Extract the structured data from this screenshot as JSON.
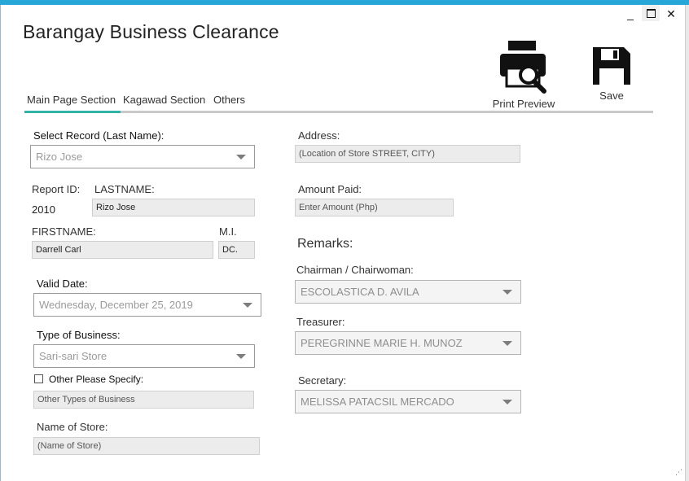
{
  "window": {
    "title": "Barangay Business Clearance",
    "controls": {
      "minimize": "_",
      "maximize": "☐",
      "close": "✕"
    }
  },
  "tabs": [
    {
      "label": "Main Page Section",
      "active": true
    },
    {
      "label": "Kagawad Section",
      "active": false
    },
    {
      "label": "Others",
      "active": false
    }
  ],
  "toolbar": {
    "print_preview_label": "Print Preview",
    "save_label": "Save"
  },
  "left": {
    "select_record_label": "Select Record (Last Name):",
    "select_record_value": "Rizo Jose",
    "report_id_label": "Report ID:",
    "report_id_value": "2010",
    "lastname_label": "LASTNAME:",
    "lastname_value": "Rizo Jose",
    "firstname_label": "FIRSTNAME:",
    "firstname_value": "Darrell Carl",
    "mi_label": "M.I.",
    "mi_value": "DC.",
    "valid_date_label": "Valid Date:",
    "valid_date_value": "Wednesday, December 25, 2019",
    "type_of_business_label": "Type of Business:",
    "type_of_business_value": "Sari-sari Store",
    "other_specify_label": "Other Please Specify:",
    "other_specify_checked": false,
    "other_types_placeholder": "Other Types of Business",
    "name_of_store_label": "Name of Store:",
    "name_of_store_placeholder": "(Name of Store)"
  },
  "right": {
    "address_label": "Address:",
    "address_placeholder": "(Location of Store STREET, CITY)",
    "amount_paid_label": "Amount Paid:",
    "amount_placeholder": "Enter Amount (Php)",
    "remarks_label": "Remarks:",
    "chairman_label": "Chairman / Chairwoman:",
    "chairman_value": "ESCOLASTICA D. AVILA",
    "treasurer_label": "Treasurer:",
    "treasurer_value": "PEREGRINNE MARIE H. MUNOZ",
    "secretary_label": "Secretary:",
    "secretary_value": "MELISSA PATACSIL MERCADO"
  },
  "colors": {
    "title_strip": "#27a7d8",
    "tab_underline_active": "#32b3a8",
    "tab_underline": "#c9c9c9",
    "textbox_bg": "#ececec"
  },
  "icons": [
    "printer-search-icon",
    "floppy-disk-icon",
    "resize-grip-icon"
  ]
}
